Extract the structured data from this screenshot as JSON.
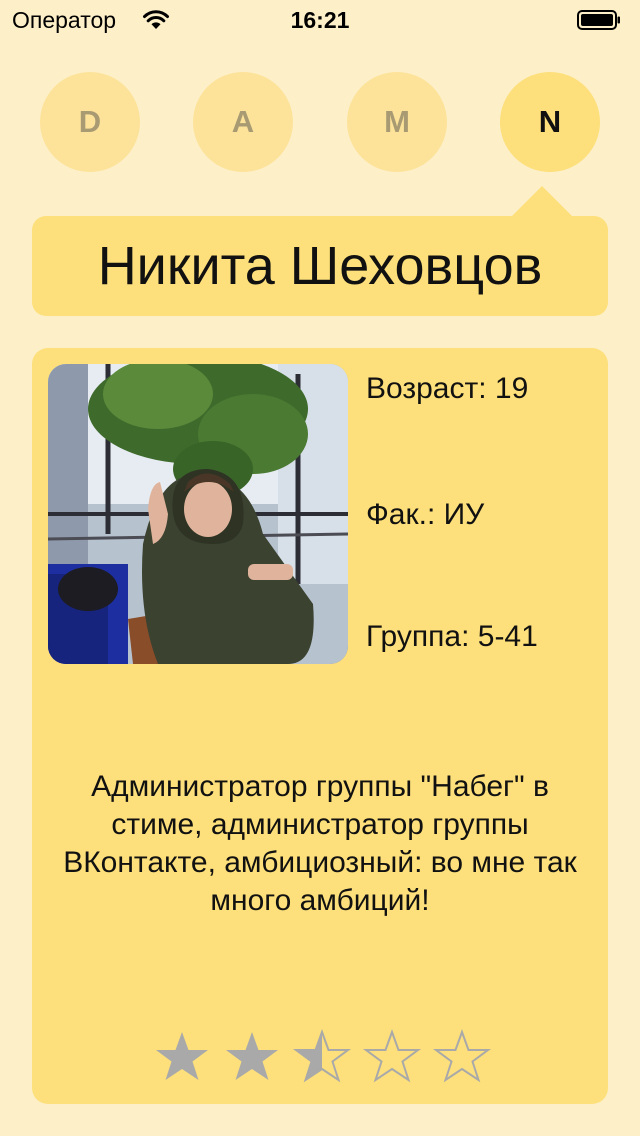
{
  "status_bar": {
    "carrier": "Оператор",
    "time": "16:21"
  },
  "tabs": [
    {
      "label": "D"
    },
    {
      "label": "A"
    },
    {
      "label": "M"
    },
    {
      "label": "N"
    }
  ],
  "active_tab": "N",
  "profile": {
    "name": "Никита Шеховцов",
    "age": "Возраст: 19",
    "faculty": "Фак.: ИУ",
    "group": "Группа: 5-41",
    "description": "Администратор группы \"Набег\" в стиме, администратор группы ВКонтакте, амбициозный: во мне так много амбиций!",
    "rating": 2.5,
    "rating_max": 5
  },
  "colors": {
    "background": "#fdefc8",
    "tab_inactive": "#fde39a",
    "accent": "#fde07b",
    "star_filled": "#a9a9a9",
    "star_empty_stroke": "#a9a9a9"
  },
  "icons": {
    "wifi": "wifi-icon",
    "battery": "battery-icon",
    "star": "star-icon"
  }
}
